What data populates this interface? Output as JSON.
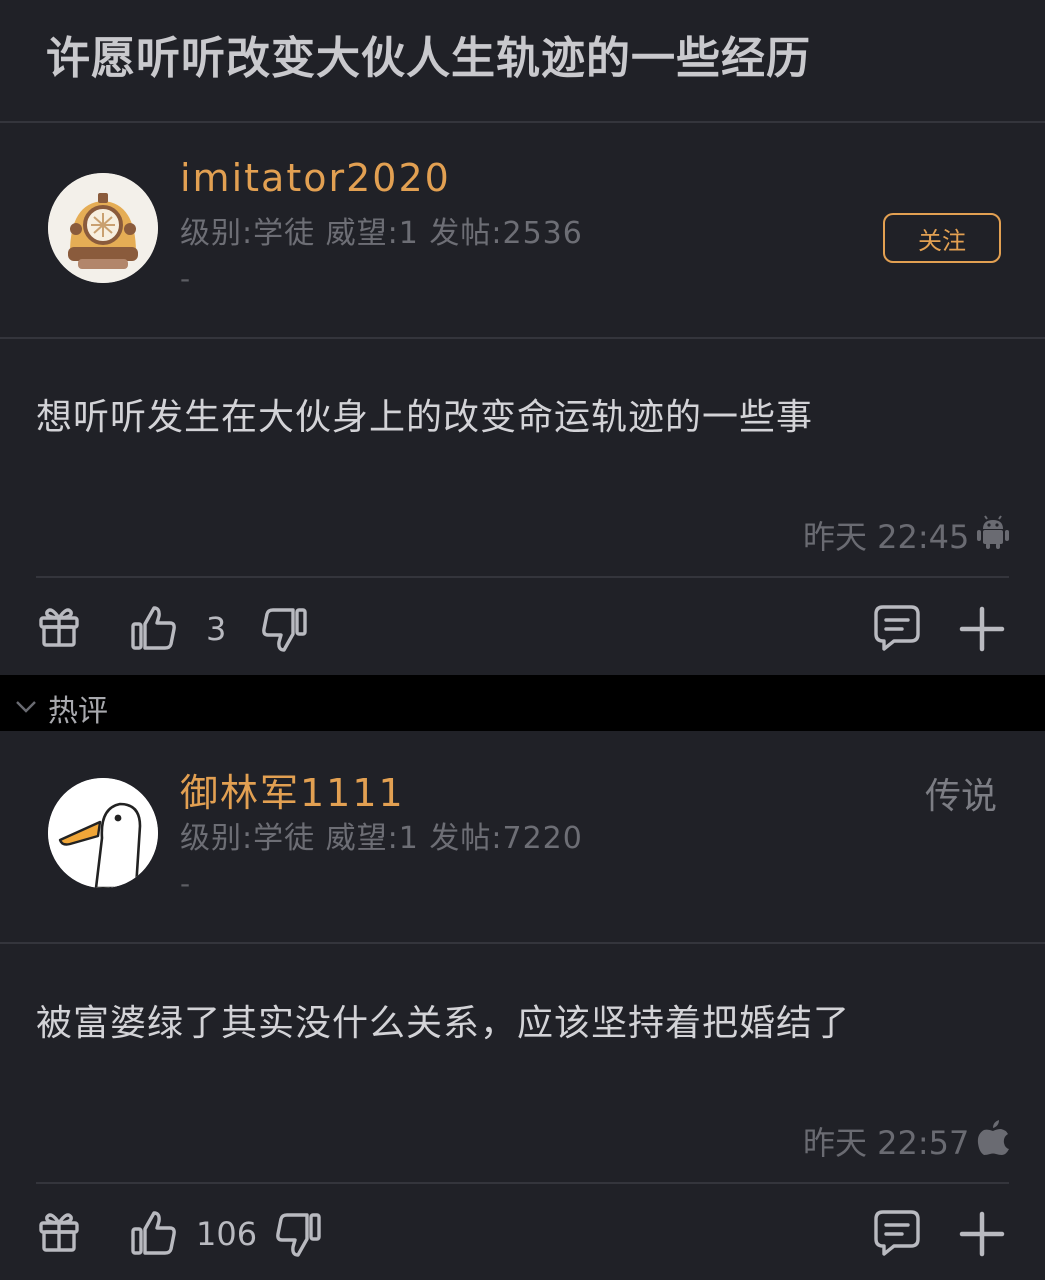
{
  "thread": {
    "title": "许愿听听改变大伙人生轨迹的一些经历"
  },
  "post": {
    "username": "imitator2020",
    "meta": "级别:学徒 威望:1 发帖:2536",
    "signature": "-",
    "follow_label": "关注",
    "content": "想听听发生在大伙身上的改变命运轨迹的一些事",
    "time": "昨天 22:45",
    "device_icon": "android-icon",
    "likes": "3"
  },
  "hot_section": {
    "label": "热评"
  },
  "comment": {
    "username": "御林军1111",
    "badge": "传说",
    "meta": "级别:学徒 威望:1 发帖:7220",
    "signature": "-",
    "content": "被富婆绿了其实没什么关系，应该坚持着把婚结了",
    "time": "昨天 22:57",
    "device_icon": "apple-icon",
    "likes": "106"
  },
  "colors": {
    "background": "#202127",
    "accent": "#e2a052",
    "muted": "#6d6e75"
  }
}
